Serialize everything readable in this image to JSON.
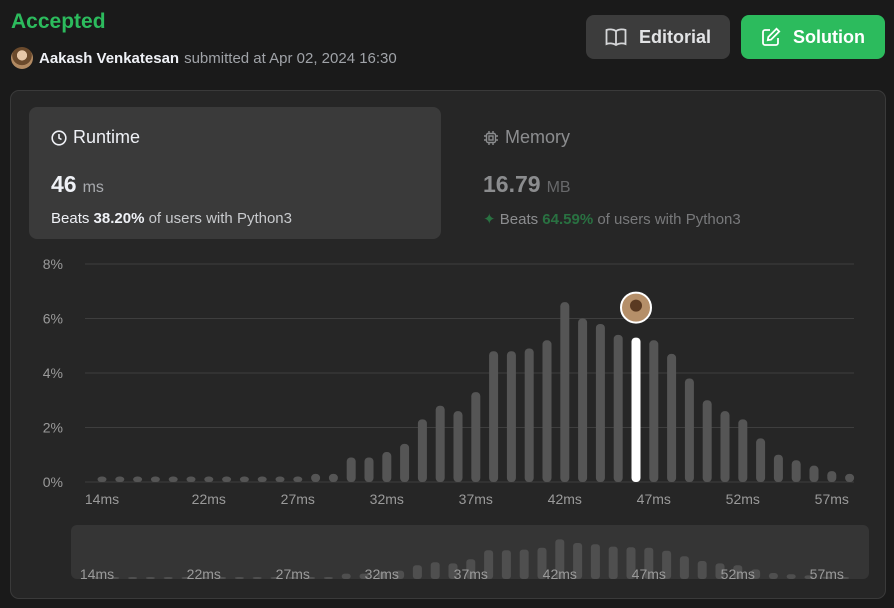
{
  "header": {
    "status": "Accepted",
    "user_name": "Aakash Venkatesan",
    "submitted_text": "submitted at Apr 02, 2024 16:30",
    "editorial_label": "Editorial",
    "solution_label": "Solution"
  },
  "runtime": {
    "title": "Runtime",
    "value": "46",
    "unit": "ms",
    "beats_label": "Beats",
    "beats_pct": "38.20%",
    "beats_rest": "of users with Python3"
  },
  "memory": {
    "title": "Memory",
    "value": "16.79",
    "unit": "MB",
    "beats_label": "Beats",
    "beats_pct": "64.59%",
    "beats_rest": "of users with Python3"
  },
  "colors": {
    "accent_green": "#2cbb5d",
    "bar": "#555555",
    "selected_bar": "#ffffff"
  },
  "chart_data": {
    "type": "bar",
    "ylim": [
      0,
      8
    ],
    "yticks": [
      "0%",
      "2%",
      "4%",
      "6%",
      "8%"
    ],
    "ytick_values": [
      0,
      2,
      4,
      6,
      8
    ],
    "x_labels": [
      "14ms",
      "22ms",
      "27ms",
      "32ms",
      "37ms",
      "42ms",
      "47ms",
      "52ms",
      "57ms"
    ],
    "x_label_indices": [
      0,
      6,
      11,
      16,
      21,
      26,
      31,
      36,
      41
    ],
    "values": [
      0.2,
      0.2,
      0.2,
      0.2,
      0.2,
      0.2,
      0.2,
      0.2,
      0.2,
      0.2,
      0.2,
      0.2,
      0.3,
      0.3,
      0.9,
      0.9,
      1.1,
      1.4,
      2.3,
      2.8,
      2.6,
      3.3,
      4.8,
      4.8,
      4.9,
      5.2,
      6.6,
      6.0,
      5.8,
      5.4,
      5.3,
      5.2,
      4.7,
      3.8,
      3.0,
      2.6,
      2.3,
      1.6,
      1.0,
      0.8,
      0.6,
      0.4,
      0.3
    ],
    "selected_index": 30,
    "grid": true
  }
}
